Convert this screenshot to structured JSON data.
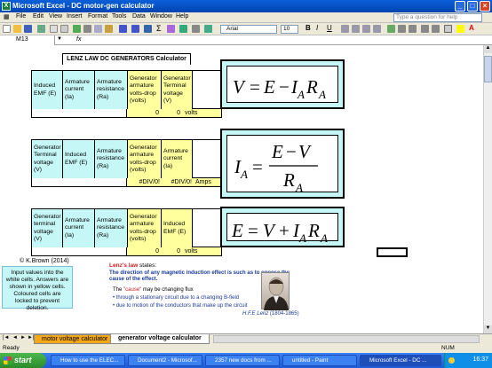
{
  "window": {
    "title": "Microsoft Excel - DC motor-gen calculator",
    "app_icon": "excel-icon"
  },
  "menu": {
    "items": [
      "File",
      "Edit",
      "View",
      "Insert",
      "Format",
      "Tools",
      "Data",
      "Window",
      "Help"
    ],
    "help_placeholder": "Type a question for help"
  },
  "toolbar": {
    "font": "Arial",
    "size": "10"
  },
  "formula_bar": {
    "cell_ref": "M13",
    "fx": "fx",
    "content": ""
  },
  "sheet": {
    "heading": "LENZ LAW DC GENERATORS Calculator",
    "block1": {
      "headers": [
        "Induced EMF (E)",
        "Armature current (Ia)",
        "Armature resistance (Ra)",
        "Generator armature volts-drop (volts)",
        "Generator Terminal voltage (V)"
      ],
      "values": [
        "0",
        "0",
        "volts"
      ],
      "formula": "V = E − I_A R_A"
    },
    "block2": {
      "headers": [
        "Generator Terminal voltage (V)",
        "Induced EMF (E)",
        "Armature resistance (Ra)",
        "Generator armature volts-drop (volts)",
        "Armature current (Ia)"
      ],
      "values": [
        "#DIV/0!",
        "#DIV/0!",
        "Amps"
      ],
      "formula": "I_A = (E − V) / R_A"
    },
    "block3": {
      "headers": [
        "Generator terminal voltage (V)",
        "Armature current (Ia)",
        "Armature resistance (Ra)",
        "Generator armature volts-drop (volts)",
        "Induced EMF (E)"
      ],
      "values": [
        "0",
        "0",
        "volts"
      ],
      "formula": "E = V + I_A R_A"
    },
    "copyright": "© K.Brown (2014)",
    "instructions": "Input values into the white cells. Answers are shown in yellow cells. Coloured cells are locked to prevent deletion.",
    "lenz": {
      "title_bold": "Lenz's law",
      "title_rest": " states:",
      "statement": "The direction of any magnetic induction effect is such as to oppose the cause of the effect.",
      "cause_pre": "The ",
      "cause_word": "\"cause\"",
      "cause_post": " may be changing flux",
      "bullet1": "• through a stationary circuit due to a changing B-field",
      "bullet2": "• due to motion of the conductors that make up the circuit",
      "signature_name": "H.F.E Lenz",
      "signature_years": " (1804-1865)"
    }
  },
  "tabs": {
    "items": [
      "motor voltage calculator",
      "generator voltage calculator"
    ],
    "active": 1
  },
  "status": {
    "left": "Ready",
    "right": "NUM"
  },
  "taskbar": {
    "start": "start",
    "tasks": [
      "How to use the ELEC...",
      "Document2 - Microsof...",
      "2357 new docs from ...",
      "untitled - Paint",
      "Microsoft Excel - DC ..."
    ],
    "clock": "16:37"
  },
  "colors": {
    "input_cell": "#c6f7f7",
    "answer_cell": "#ffff9e",
    "lenz_red": "#d02020",
    "lenz_blue": "#1a3a9a"
  }
}
